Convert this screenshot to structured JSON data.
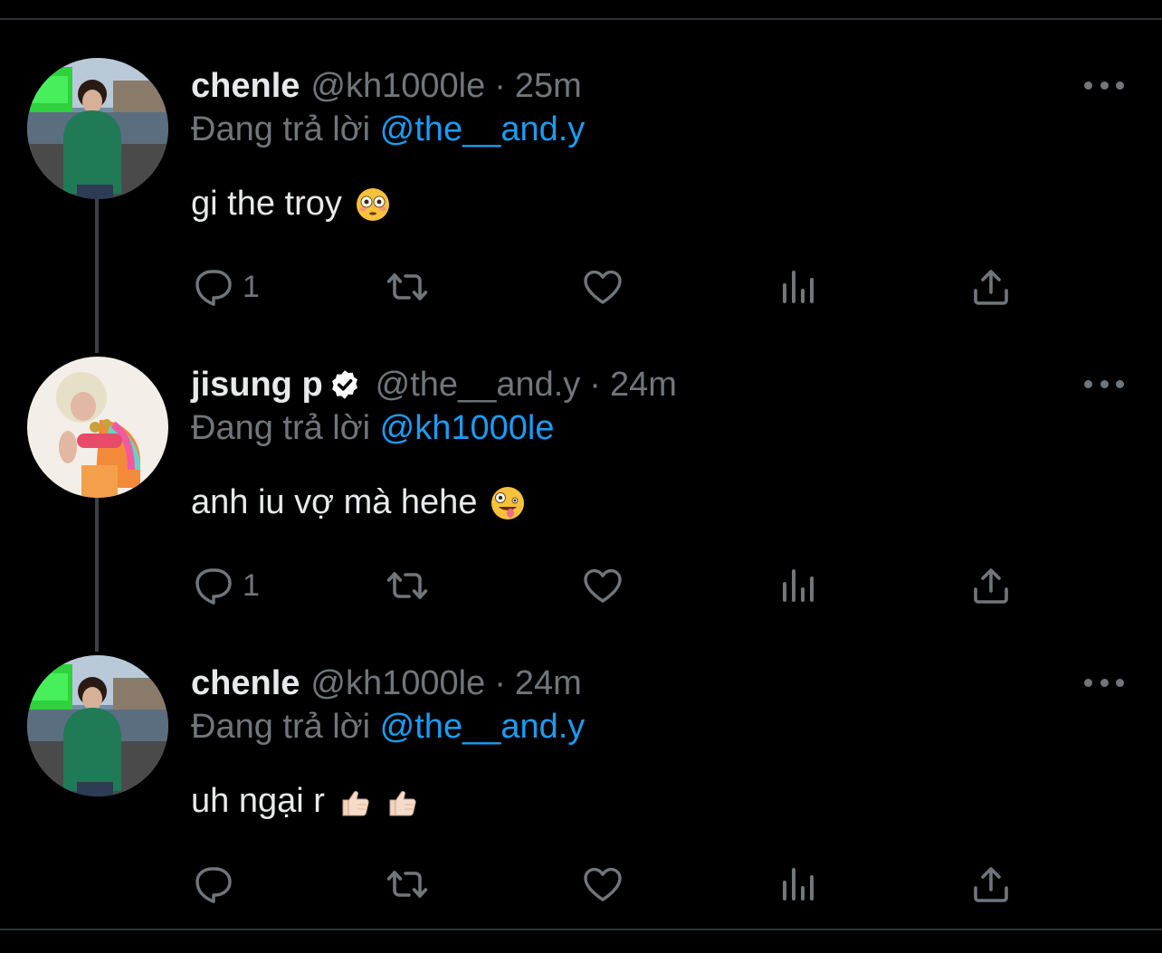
{
  "colors": {
    "background": "#000000",
    "text": "#e7e9ea",
    "muted": "#71767b",
    "mention": "#1d9bf0",
    "verified": "#ffffff"
  },
  "reply_prefix": "Đang trả lời",
  "tweets": [
    {
      "name": "chenle",
      "verified": false,
      "handle": "@kh1000le",
      "dot": "·",
      "time": "25m",
      "reply_to": "@the__and.y",
      "text": "gi the troy",
      "emoji": [
        "flushed-face-emoji"
      ],
      "reply_count": "1"
    },
    {
      "name": "jisung p",
      "verified": true,
      "handle": "@the__and.y",
      "dot": "·",
      "time": "24m",
      "reply_to": "@kh1000le",
      "text": "anh iu vợ mà hehe",
      "emoji": [
        "zany-face-emoji"
      ],
      "reply_count": "1"
    },
    {
      "name": "chenle",
      "verified": false,
      "handle": "@kh1000le",
      "dot": "·",
      "time": "24m",
      "reply_to": "@the__and.y",
      "text": "uh ngại r",
      "emoji": [
        "thumbs-up-emoji",
        "thumbs-up-emoji"
      ],
      "reply_count": ""
    }
  ]
}
